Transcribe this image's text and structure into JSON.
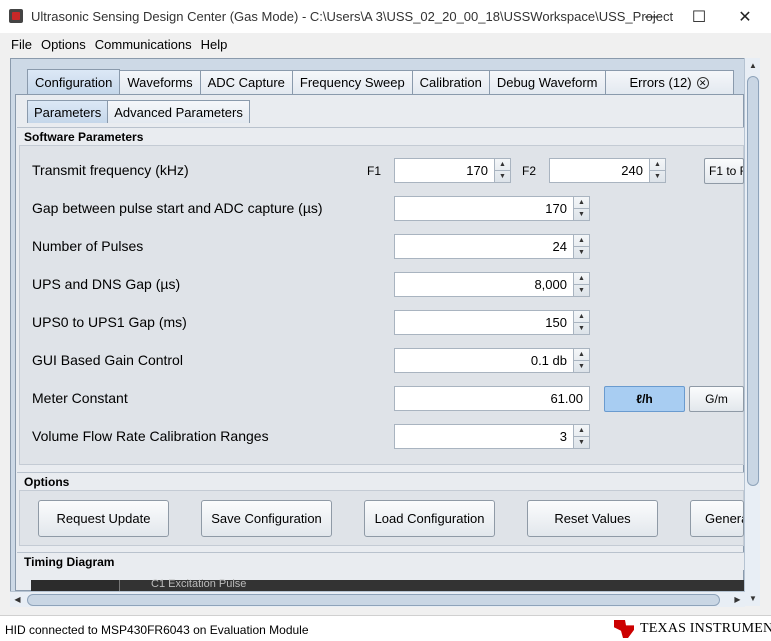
{
  "window": {
    "title": "Ultrasonic Sensing Design Center (Gas Mode) - C:\\Users\\A      3\\USS_02_20_00_18\\USSWorkspace\\USS_Project",
    "minimize": "—",
    "maximize": "☐",
    "close": "✕"
  },
  "menu": [
    "File",
    "Options",
    "Communications",
    "Help"
  ],
  "main_tabs": [
    "Configuration",
    "Waveforms",
    "ADC Capture",
    "Frequency Sweep",
    "Calibration",
    "Debug Waveform",
    "Errors (12)"
  ],
  "main_tab_close_glyph": "✕",
  "sub_tabs": [
    "Parameters",
    "Advanced Parameters"
  ],
  "software_section_title": "Software Parameters",
  "params": {
    "transmit_frequency": {
      "label": "Transmit frequency (kHz)",
      "f1_label": "F1",
      "f1_value": "170",
      "f2_label": "F2",
      "f2_value": "240",
      "button": "F1 to F"
    },
    "gap_pulse_adc": {
      "label": "Gap between pulse start and ADC capture (µs)",
      "value": "170"
    },
    "num_pulses": {
      "label": "Number of Pulses",
      "value": "24"
    },
    "ups_dns_gap": {
      "label": "UPS and DNS Gap (µs)",
      "value": "8,000"
    },
    "ups0_ups1_gap": {
      "label": "UPS0 to UPS1 Gap (ms)",
      "value": "150"
    },
    "gain_control": {
      "label": "GUI Based Gain Control",
      "value": "0.1 db"
    },
    "meter_constant": {
      "label": "Meter Constant",
      "value": "61.00",
      "unit_selected": "ℓ/h",
      "unit_other": "G/m"
    },
    "flow_cal_ranges": {
      "label": "Volume Flow Rate Calibration Ranges",
      "value": "3"
    }
  },
  "options_section_title": "Options",
  "options_buttons": [
    "Request Update",
    "Save Configuration",
    "Load Configuration",
    "Reset Values",
    "Genera"
  ],
  "timing_section_title": "Timing Diagram",
  "timing_partial_text": "C1 Excitation Pulse",
  "status": "HID connected to MSP430FR6043 on Evaluation Module",
  "brand": "TEXAS INSTRUMENTS",
  "colors": {
    "accent_selected": "#a8cdf2",
    "panel": "#cdd9e6",
    "brand_red": "#cc0000"
  }
}
